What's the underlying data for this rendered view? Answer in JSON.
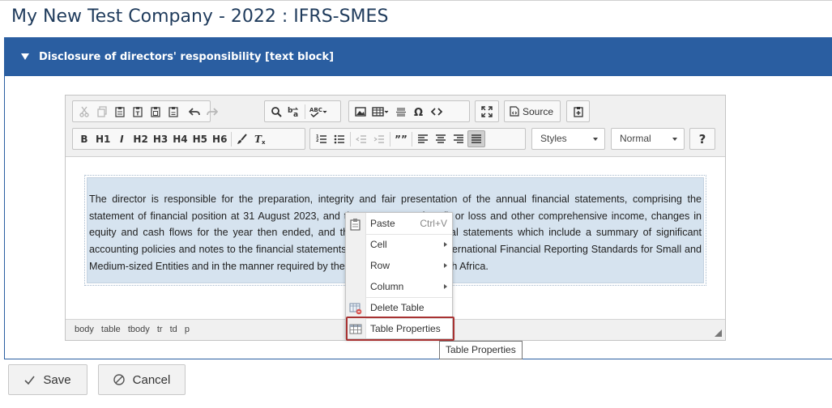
{
  "page": {
    "title": "My New Test Company - 2022 : IFRS-SMES"
  },
  "panel": {
    "header_label": "Disclosure of directors' responsibility [text block]"
  },
  "toolbar": {
    "headings": [
      "H1",
      "H2",
      "H3",
      "H4",
      "H5",
      "H6"
    ],
    "bold_label": "B",
    "italic_label": "I",
    "quote_label": "””",
    "source_label": "Source",
    "styles_value": "Styles",
    "format_value": "Normal",
    "help_label": "?"
  },
  "content": {
    "paragraph": "The director is responsible for the preparation, integrity and fair presentation of the annual financial statements, comprising the statement of financial position at 31 August 2023, and the statements of profit or loss and other comprehensive income, changes in equity and cash flows for the year then ended, and the notes to the financial statements which include a summary of significant accounting policies and notes to the financial statements, in accordance with International Financial Reporting Standards for Small and Medium-sized Entities and in the manner required by the Companies Act of South Africa."
  },
  "pathbar": {
    "items": [
      "body",
      "table",
      "tbody",
      "tr",
      "td",
      "p"
    ]
  },
  "context_menu": {
    "paste_label": "Paste",
    "paste_shortcut": "Ctrl+V",
    "cell_label": "Cell",
    "row_label": "Row",
    "column_label": "Column",
    "delete_table_label": "Delete Table",
    "table_properties_label": "Table Properties"
  },
  "tooltip": {
    "text": "Table Properties"
  },
  "actions": {
    "save_label": "Save",
    "cancel_label": "Cancel"
  },
  "colors": {
    "header_blue": "#2a5ea1",
    "title_blue": "#1f3b5c",
    "cell_bg": "#d6e3ef",
    "highlight_red": "#a83232"
  }
}
